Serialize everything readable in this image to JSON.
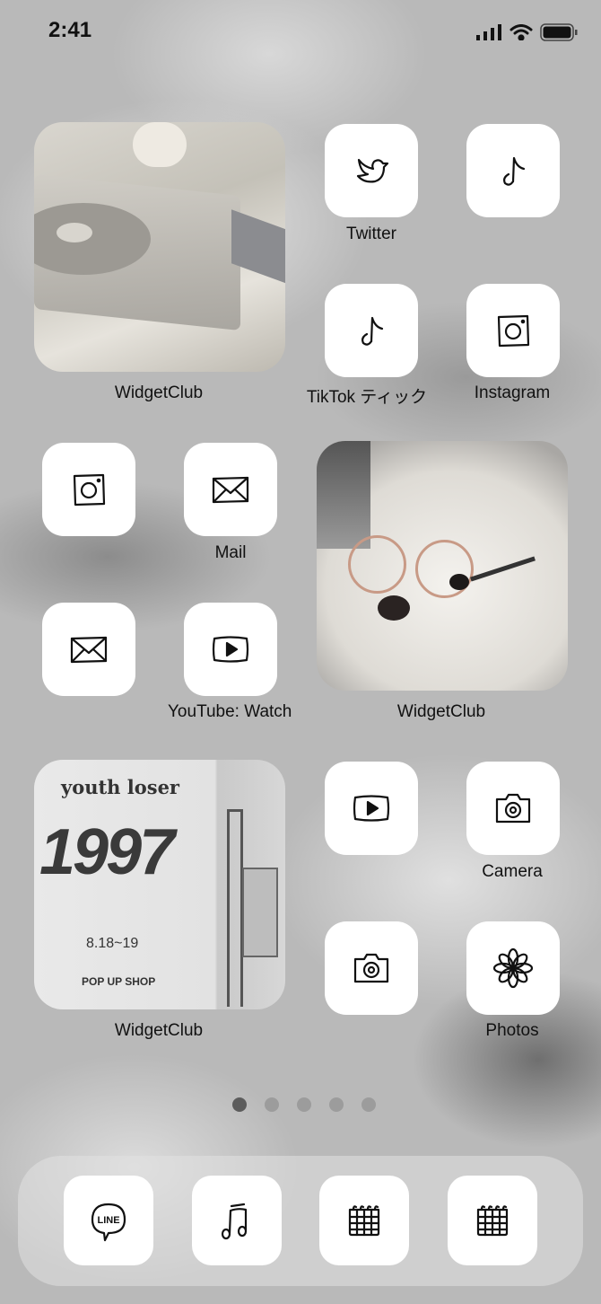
{
  "status_bar": {
    "time": "2:41"
  },
  "widgets": [
    {
      "label": "WidgetClub",
      "image": "record player photo"
    },
    {
      "label": "WidgetClub",
      "image": "pomeranian with glasses photo"
    },
    {
      "label": "WidgetClub",
      "image": "youth loser 1997 poster",
      "poster_title": "youth loser",
      "poster_year": "1997",
      "poster_date": "8.18~19",
      "poster_sub": "POP UP SHOP"
    }
  ],
  "apps": [
    {
      "label": "Twitter",
      "icon": "bird-icon"
    },
    {
      "label": "",
      "icon": "music-note-icon"
    },
    {
      "label": "TikTok ティック",
      "icon": "music-note-icon"
    },
    {
      "label": "Instagram",
      "icon": "camera-square-icon"
    },
    {
      "label": "",
      "icon": "camera-square-icon"
    },
    {
      "label": "Mail",
      "icon": "envelope-icon"
    },
    {
      "label": "",
      "icon": "envelope-icon"
    },
    {
      "label": "YouTube: Watch",
      "icon": "play-icon"
    },
    {
      "label": "",
      "icon": "play-icon"
    },
    {
      "label": "Camera",
      "icon": "camera-icon"
    },
    {
      "label": "",
      "icon": "camera-icon"
    },
    {
      "label": "Photos",
      "icon": "flower-icon"
    }
  ],
  "page_dots": {
    "count": 5,
    "active": 0
  },
  "dock": [
    {
      "icon": "line-icon",
      "text": "LINE"
    },
    {
      "icon": "music-notes-icon"
    },
    {
      "icon": "calendar-icon"
    },
    {
      "icon": "calendar-icon"
    }
  ]
}
